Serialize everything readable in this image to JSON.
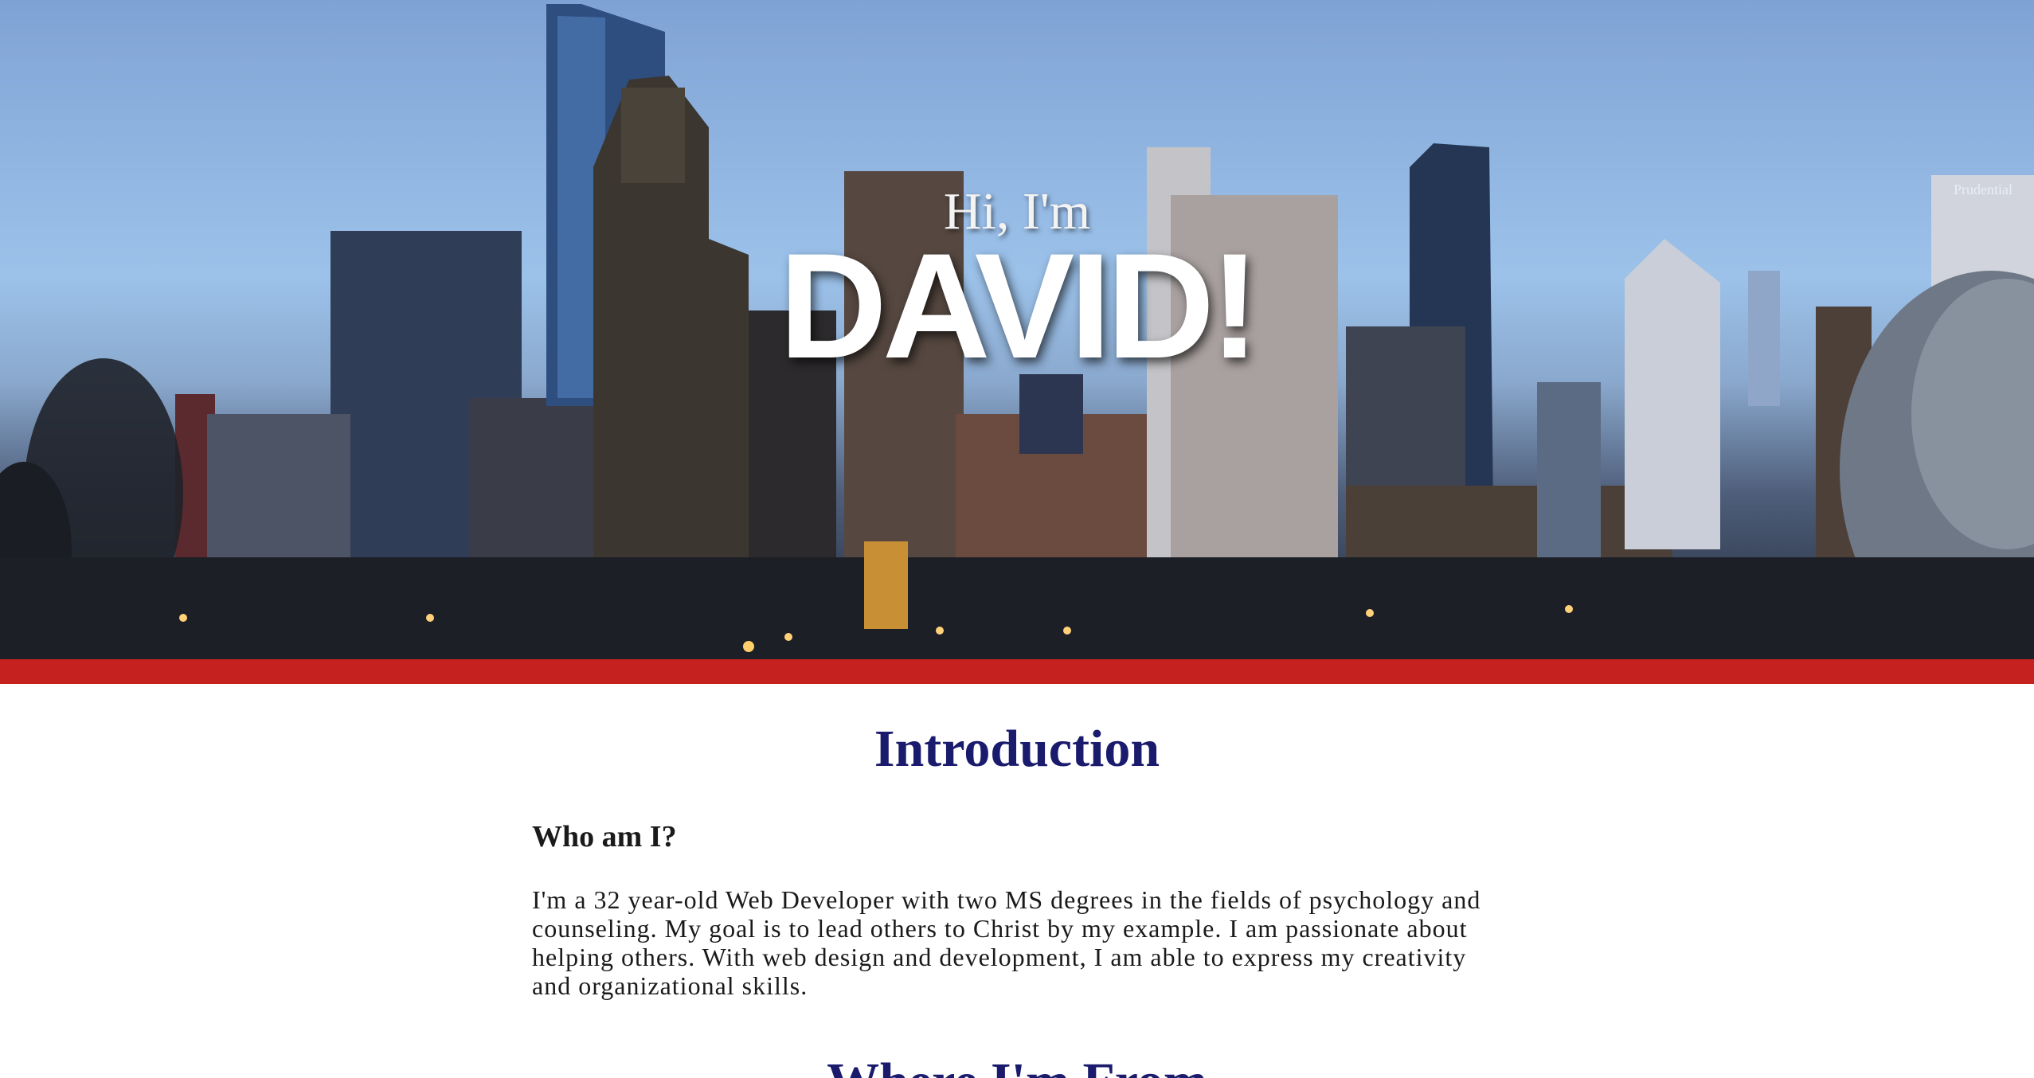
{
  "hero": {
    "greeting": "Hi, I'm",
    "name": "DAVID!",
    "building_sign": "Prudential"
  },
  "colors": {
    "accent_bar": "#c5211f",
    "heading": "#1b1b6e",
    "body_text": "#1a1a1a"
  },
  "introduction": {
    "title": "Introduction",
    "subheading": "Who am I?",
    "paragraph": "I'm a 32 year-old Web Developer with two MS degrees in the fields of psychology and counseling. My goal is to lead others to Christ by my example. I am passionate about helping others. With web design and development, I am able to express my creativity and organizational skills."
  },
  "next_section": {
    "title": "Where I'm From"
  }
}
